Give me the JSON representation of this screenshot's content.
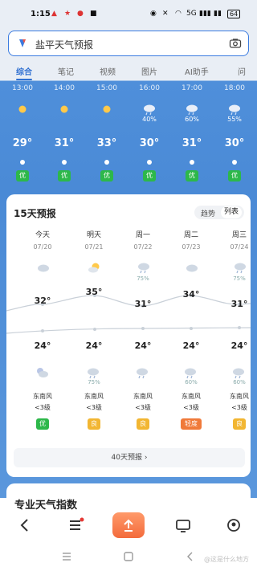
{
  "status_bar": {
    "time": "1:15",
    "network": "5G",
    "battery": "64"
  },
  "search": {
    "placeholder": "盐平天气预报"
  },
  "tabs": [
    {
      "label": "综合",
      "active": true
    },
    {
      "label": "笔记",
      "active": false
    },
    {
      "label": "视频",
      "active": false
    },
    {
      "label": "图片",
      "active": false
    },
    {
      "label": "AI助手",
      "active": false
    },
    {
      "label": "问",
      "active": false
    }
  ],
  "hourly": [
    {
      "time": "13:00",
      "icon": "sun-icon",
      "pct": "",
      "temp": "29°",
      "aq": "优"
    },
    {
      "time": "14:00",
      "icon": "sun-icon",
      "pct": "",
      "temp": "31°",
      "aq": "优"
    },
    {
      "time": "15:00",
      "icon": "sun-icon",
      "pct": "",
      "temp": "33°",
      "aq": "优"
    },
    {
      "time": "16:00",
      "icon": "rain-icon",
      "pct": "40%",
      "temp": "30°",
      "aq": "优"
    },
    {
      "time": "17:00",
      "icon": "rain-icon",
      "pct": "60%",
      "temp": "31°",
      "aq": "优"
    },
    {
      "time": "18:00",
      "icon": "rain-icon",
      "pct": "55%",
      "temp": "30°",
      "aq": "优"
    }
  ],
  "forecast": {
    "title": "15天预报",
    "toggle_trend": "趋势",
    "toggle_list": "列表",
    "more_label": "40天预报 ›",
    "days": [
      {
        "name": "今天",
        "date": "07/20",
        "day_icon": "cloud-icon",
        "day_pct": "",
        "high": "32°",
        "low": "24°",
        "night_icon": "cloud-moon-icon",
        "night_pct": "",
        "wind": "东南风",
        "level": "<3级",
        "aq": "优",
        "aq_color": "#2db84a"
      },
      {
        "name": "明天",
        "date": "07/21",
        "day_icon": "sun-cloud-icon",
        "day_pct": "",
        "high": "35°",
        "low": "24°",
        "night_icon": "rain-icon",
        "night_pct": "75%",
        "wind": "东南风",
        "level": "<3级",
        "aq": "良",
        "aq_color": "#f2b632"
      },
      {
        "name": "周一",
        "date": "07/22",
        "day_icon": "rain-icon",
        "day_pct": "75%",
        "high": "31°",
        "low": "24°",
        "night_icon": "rain-icon",
        "night_pct": "",
        "wind": "东南风",
        "level": "<3级",
        "aq": "良",
        "aq_color": "#f2b632"
      },
      {
        "name": "周二",
        "date": "07/23",
        "day_icon": "cloud-icon",
        "day_pct": "",
        "high": "34°",
        "low": "24°",
        "night_icon": "rain-icon",
        "night_pct": "60%",
        "wind": "东南风",
        "level": "<3级",
        "aq": "轻度",
        "aq_color": "#f07a3a"
      },
      {
        "name": "周三",
        "date": "07/24",
        "day_icon": "rain-icon",
        "day_pct": "75%",
        "high": "31°",
        "low": "24°",
        "night_icon": "rain-icon",
        "night_pct": "60%",
        "wind": "东南风",
        "level": "<3级",
        "aq": "良",
        "aq_color": "#f2b632"
      }
    ]
  },
  "pro_index": {
    "title": "专业天气指数"
  },
  "watermark": "@这是什么地方"
}
